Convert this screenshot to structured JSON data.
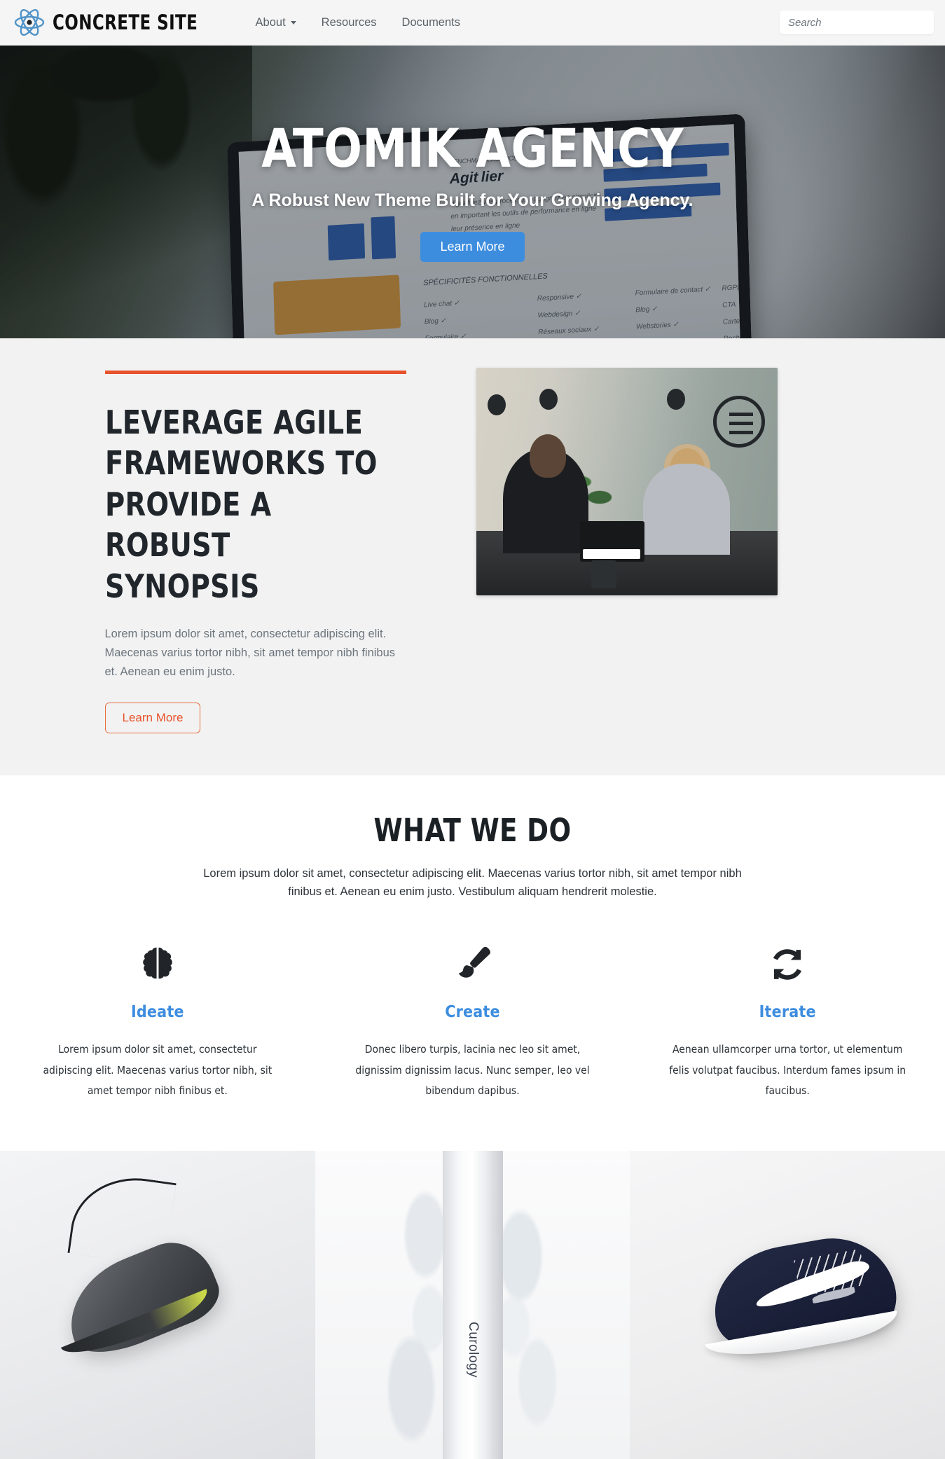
{
  "navbar": {
    "brand": {
      "text": "CONCRETE SITE",
      "logo_icon": "atom-icon"
    },
    "links": [
      {
        "label": "About",
        "has_dropdown": true
      },
      {
        "label": "Resources",
        "has_dropdown": false
      },
      {
        "label": "Documents",
        "has_dropdown": false
      }
    ],
    "search": {
      "placeholder": "Search",
      "value": "",
      "button_icon": "search-icon"
    }
  },
  "hero": {
    "title": "ATOMIK AGENCY",
    "subtitle": "A Robust New Theme Built for Your Growing Agency.",
    "cta_label": "Learn More",
    "cta_color": "#3d8ddf"
  },
  "leverage": {
    "accent_color": "#e8522a",
    "heading": "LEVERAGE AGILE FRAMEWORKS TO PROVIDE A ROBUST SYNOPSIS",
    "paragraph": "Lorem ipsum dolor sit amet, consectetur adipiscing elit. Maecenas varius tortor nibh, sit amet tempor nibh finibus et. Aenean eu enim justo.",
    "cta_label": "Learn More",
    "image_alt": "two people talking at a meeting table"
  },
  "what_we_do": {
    "heading": "WHAT WE DO",
    "lead": "Lorem ipsum dolor sit amet, consectetur adipiscing elit. Maecenas varius tortor nibh, sit amet tempor nibh finibus et. Aenean eu enim justo. Vestibulum aliquam hendrerit molestie.",
    "accent_color": "#3d8ddf",
    "features": [
      {
        "icon": "brain-icon",
        "title": "Ideate",
        "text": "Lorem ipsum dolor sit amet, consectetur adipiscing elit. Maecenas varius tortor nibh, sit amet tempor nibh finibus et."
      },
      {
        "icon": "paint-brush-icon",
        "title": "Create",
        "text": "Donec libero turpis, lacinia nec leo sit amet, dignissim dignissim lacus. Nunc semper, leo vel bibendum dapibus."
      },
      {
        "icon": "sync-arrows-icon",
        "title": "Iterate",
        "text": "Aenean ullamcorper urna tortor, ut elementum felis volutpat faucibus. Interdum fames ipsum in faucibus."
      }
    ]
  },
  "gallery": {
    "tiles": [
      {
        "alt": "dark grey running sneaker on light background"
      },
      {
        "alt": "white skincare tube with clear gel",
        "label": "Curology"
      },
      {
        "alt": "navy blue suede sneaker with white stripe"
      }
    ]
  }
}
